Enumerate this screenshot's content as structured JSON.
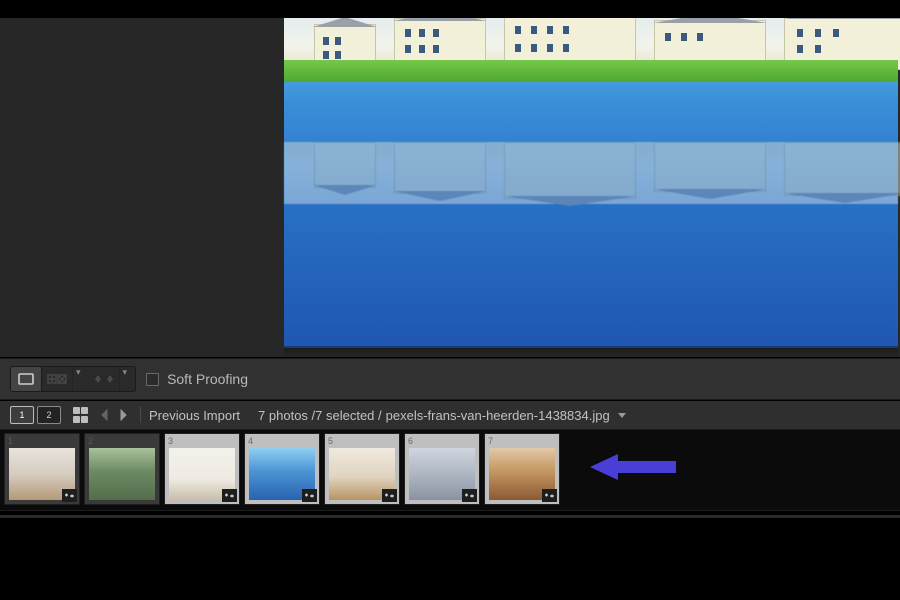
{
  "toolbar": {
    "soft_proofing_label": "Soft Proofing"
  },
  "filmstrip_header": {
    "monitor_1": "1",
    "monitor_2": "2",
    "folder_label": "Previous Import",
    "count_label": "7 photos /7 selected /",
    "current_file": "pexels-frans-van-heerden-1438834.jpg"
  },
  "filmstrip": {
    "thumbs": [
      {
        "index": "1",
        "selected": false,
        "has_develop_badge": true,
        "cls": "t-interior"
      },
      {
        "index": "2",
        "selected": false,
        "has_develop_badge": false,
        "cls": "t-house"
      },
      {
        "index": "3",
        "selected": true,
        "has_develop_badge": true,
        "cls": "t-light"
      },
      {
        "index": "4",
        "selected": true,
        "has_develop_badge": true,
        "cls": "t-water"
      },
      {
        "index": "5",
        "selected": true,
        "has_develop_badge": true,
        "cls": "t-dining"
      },
      {
        "index": "6",
        "selected": true,
        "has_develop_badge": true,
        "cls": "t-gray"
      },
      {
        "index": "7",
        "selected": true,
        "has_develop_badge": true,
        "cls": "t-warm"
      }
    ]
  }
}
